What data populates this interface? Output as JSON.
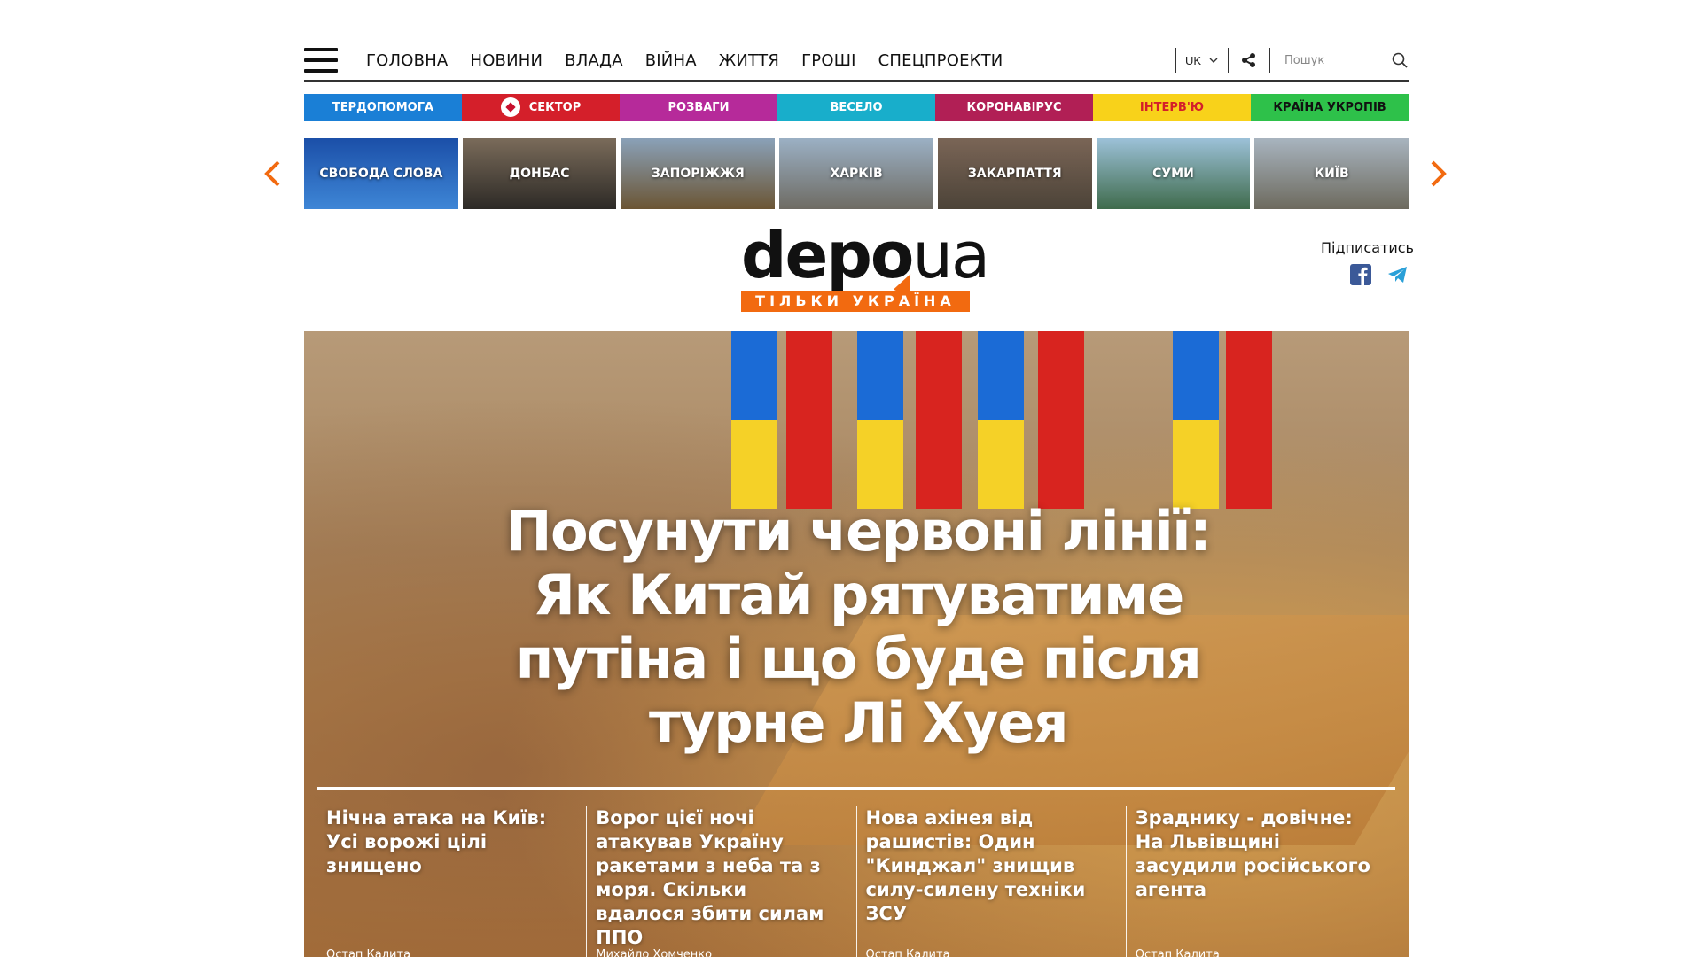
{
  "nav": {
    "items": [
      "ГОЛОВНА",
      "НОВИНИ",
      "ВЛАДА",
      "ВІЙНА",
      "ЖИТТЯ",
      "ГРОШІ",
      "СПЕЦПРОЕКТИ"
    ],
    "lang": "UK",
    "search_placeholder": "Пошук"
  },
  "categories": [
    {
      "label": "ТЕРДОПОМОГА",
      "color": "#1a7fd6"
    },
    {
      "label": "СЕКТОР",
      "color": "#d41f2a"
    },
    {
      "label": "РОЗВАГИ",
      "color": "#b62a9a"
    },
    {
      "label": "ВЕСЕЛО",
      "color": "#18aecb"
    },
    {
      "label": "КОРОНАВІРУС",
      "color": "#b11f55"
    },
    {
      "label": "ІНТЕРВ'Ю",
      "color": "#f8d21a",
      "text_color": "#d41f2a"
    },
    {
      "label": "КРАЇНА УКРОПІВ",
      "color": "#2ec14a",
      "text_color": "#111111"
    }
  ],
  "regions": [
    {
      "label": "СВОБОДА СЛОВА",
      "tone": [
        "#1b4fa8",
        "#3e86d6"
      ]
    },
    {
      "label": "ДОНБАС",
      "tone": [
        "#7a6b5a",
        "#2d2a26"
      ]
    },
    {
      "label": "ЗАПОРІЖЖЯ",
      "tone": [
        "#8aa1b8",
        "#6b5534"
      ]
    },
    {
      "label": "ХАРКІВ",
      "tone": [
        "#9bb0c4",
        "#6e6b63"
      ]
    },
    {
      "label": "ЗАКАРПАТТЯ",
      "tone": [
        "#7a6556",
        "#4c4338"
      ]
    },
    {
      "label": "СУМИ",
      "tone": [
        "#9cc1d8",
        "#3f6b4c"
      ]
    },
    {
      "label": "КИЇВ",
      "tone": [
        "#a8b4bf",
        "#6d6a5e"
      ]
    }
  ],
  "logo": {
    "main": "depo",
    "tld": "ua",
    "slogan": "ТІЛЬКИ УКРАЇНА"
  },
  "subscribe": {
    "label": "Підписатись"
  },
  "hero": {
    "title": "Посунути червоні лінії: Як Китай рятуватиме путіна і що буде після турне Лі Хуея",
    "teasers": [
      {
        "title": "Нічна атака на Київ: Усі ворожі цілі знищено",
        "author": "Остап Калита"
      },
      {
        "title": "Ворог цієї ночі атакував Україну ракетами з неба та з моря. Скільки вдалося збити силам ППО",
        "author": "Михайло Хомченко"
      },
      {
        "title": "Нова ахінея від рашистів: Один \"Кинджал\" знищив силу-силену техніки ЗСУ",
        "author": "Остап Калита"
      },
      {
        "title": "Зраднику - довічне: На Львівщині засудили російського агента",
        "author": "Остап Калита"
      }
    ]
  },
  "colors": {
    "accent": "#f26a10",
    "facebook": "#3b5998",
    "telegram": "#2aa0d8"
  }
}
